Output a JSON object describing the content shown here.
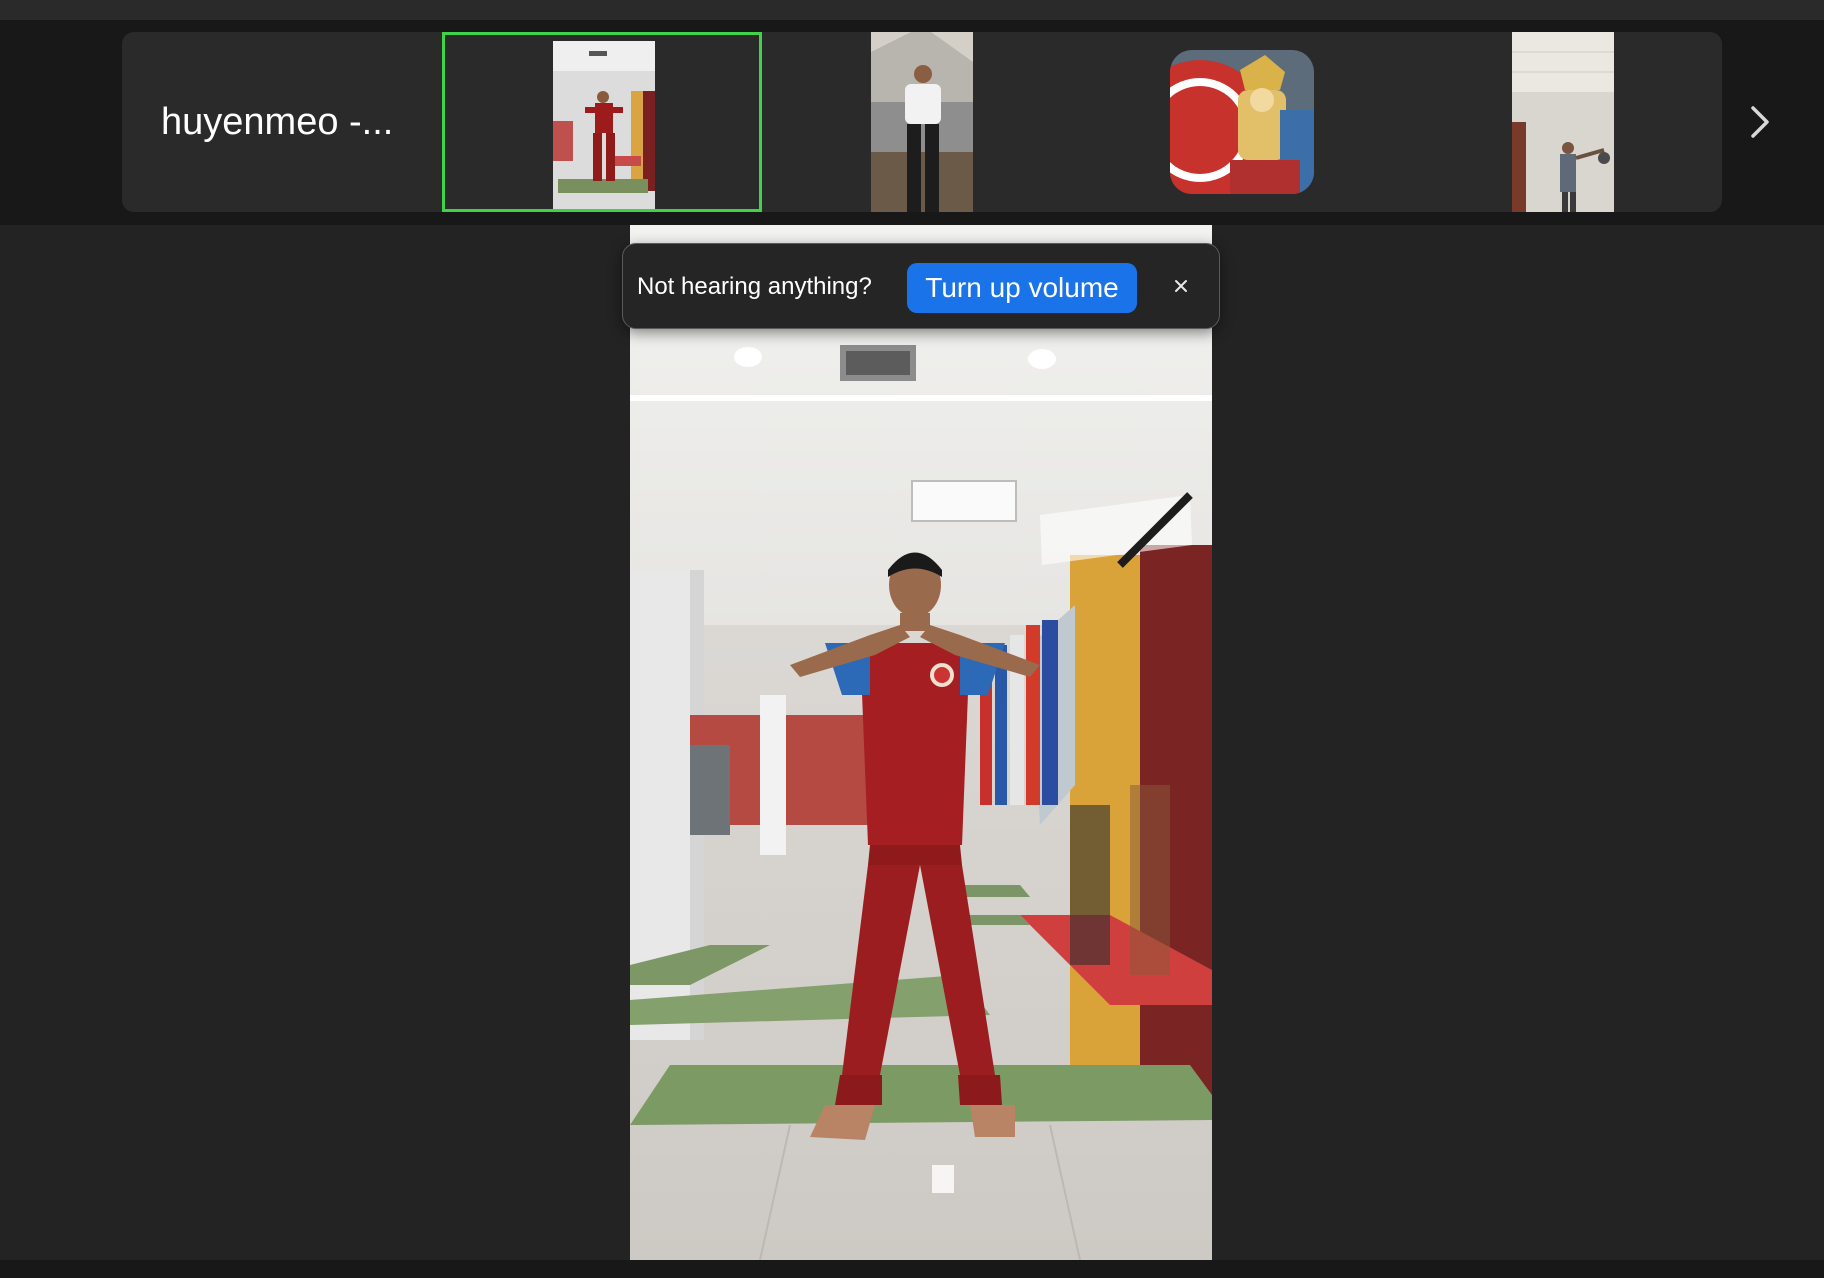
{
  "filmstrip": {
    "active_speaker_name": "huyenmeo -...",
    "participants": [
      {
        "id": "p1",
        "selected": true
      },
      {
        "id": "p2",
        "selected": false
      },
      {
        "id": "p3",
        "selected": false
      },
      {
        "id": "p4",
        "selected": false
      }
    ],
    "next_icon": "chevron-right-icon"
  },
  "toast": {
    "message": "Not hearing anything?",
    "action_label": "Turn up volume",
    "close_icon": "close-icon"
  },
  "colors": {
    "selected_border": "#3ed349",
    "action_button": "#1a73e8",
    "background": "#1c1c1c"
  }
}
